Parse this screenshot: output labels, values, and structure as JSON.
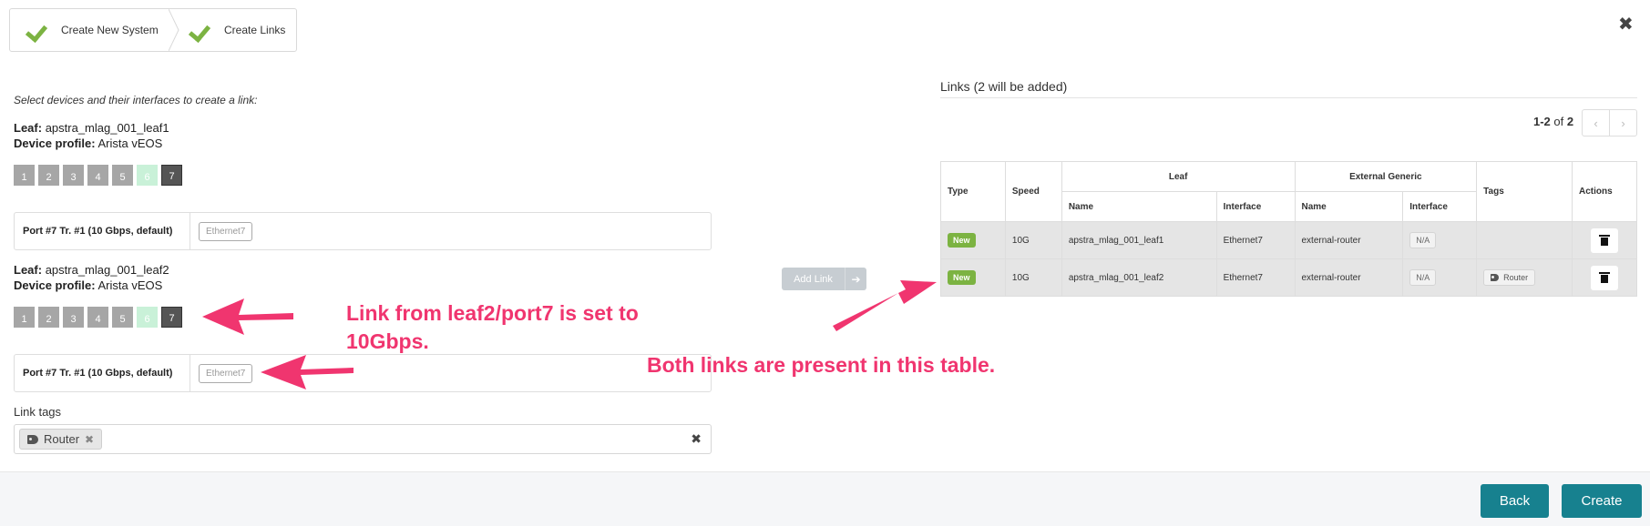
{
  "wizard": {
    "steps": [
      {
        "label": "Create New System"
      },
      {
        "label": "Create Links"
      }
    ]
  },
  "left": {
    "instruction": "Select devices and their interfaces to create a link:",
    "leafs": [
      {
        "leaf_label": "Leaf:",
        "leaf_name": "apstra_mlag_001_leaf1",
        "profile_label": "Device profile:",
        "profile_name": "Arista vEOS",
        "ports": [
          "1",
          "2",
          "3",
          "4",
          "5",
          "6",
          "7"
        ],
        "port_row_label": "Port #7 Tr. #1 (10 Gbps, default)",
        "interface": "Ethernet7"
      },
      {
        "leaf_label": "Leaf:",
        "leaf_name": "apstra_mlag_001_leaf2",
        "profile_label": "Device profile:",
        "profile_name": "Arista vEOS",
        "ports": [
          "1",
          "2",
          "3",
          "4",
          "5",
          "6",
          "7"
        ],
        "port_row_label": "Port #7 Tr. #1 (10 Gbps, default)",
        "interface": "Ethernet7"
      }
    ],
    "link_tags_label": "Link tags",
    "tags": [
      "Router"
    ]
  },
  "add_link_label": "Add Link",
  "right": {
    "title": "Links (2 will be added)",
    "pager_range": "1-2",
    "pager_of": "of",
    "pager_total": "2",
    "columns": {
      "type": "Type",
      "speed": "Speed",
      "leaf": "Leaf",
      "external": "External Generic",
      "name": "Name",
      "interface": "Interface",
      "tags": "Tags",
      "actions": "Actions"
    },
    "rows": [
      {
        "status": "New",
        "speed": "10G",
        "leaf_name": "apstra_mlag_001_leaf1",
        "leaf_interface": "Ethernet7",
        "ext_name": "external-router",
        "ext_interface": "N/A",
        "tag": ""
      },
      {
        "status": "New",
        "speed": "10G",
        "leaf_name": "apstra_mlag_001_leaf2",
        "leaf_interface": "Ethernet7",
        "ext_name": "external-router",
        "ext_interface": "N/A",
        "tag": "Router"
      }
    ]
  },
  "annotations": {
    "port_note_line1": "Link from leaf2/port7 is set to",
    "port_note_line2": "10Gbps.",
    "table_note": "Both links are present in this table."
  },
  "footer": {
    "back": "Back",
    "create": "Create"
  },
  "colors": {
    "accent": "#17818f",
    "success": "#7cb342",
    "annotation": "#f0356f"
  }
}
